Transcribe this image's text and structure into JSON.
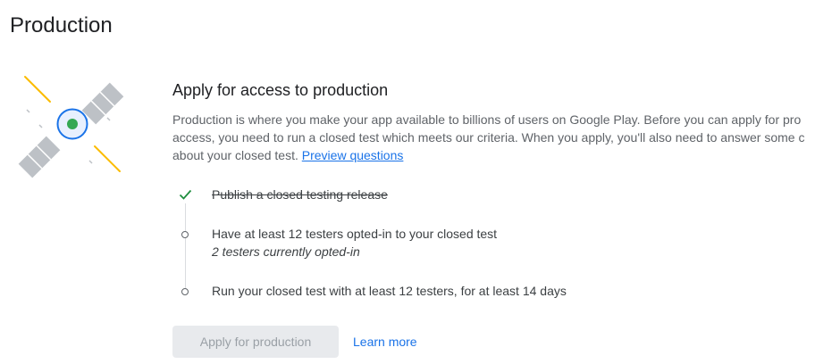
{
  "page": {
    "title": "Production"
  },
  "card": {
    "title": "Apply for access to production",
    "description_line1": "Production is where you make your app available to billions of users on Google Play. Before you can apply for pro",
    "description_line2": "access, you need to run a closed test which meets our criteria. When you apply, you'll also need to answer some c",
    "description_line3": "about your closed test.",
    "preview_link": "Preview questions"
  },
  "steps": [
    {
      "label": "Publish a closed testing release",
      "status": "complete",
      "icon": "check-icon"
    },
    {
      "label": "Have at least 12 testers opted-in to your closed test",
      "sub": "2 testers currently opted-in",
      "status": "pending",
      "icon": "circle-icon"
    },
    {
      "label": "Run your closed test with at least 12 testers, for at least 14 days",
      "status": "pending",
      "icon": "circle-icon"
    }
  ],
  "actions": {
    "apply_label": "Apply for production",
    "apply_disabled": true,
    "learn_more_label": "Learn more"
  },
  "colors": {
    "accent": "#1a73e8",
    "success": "#1e8e3e",
    "satellite_body": "#1a73e8",
    "satellite_core": "#34a853",
    "solar_panel": "#bdc1c6",
    "beam": "#fbbc04"
  }
}
